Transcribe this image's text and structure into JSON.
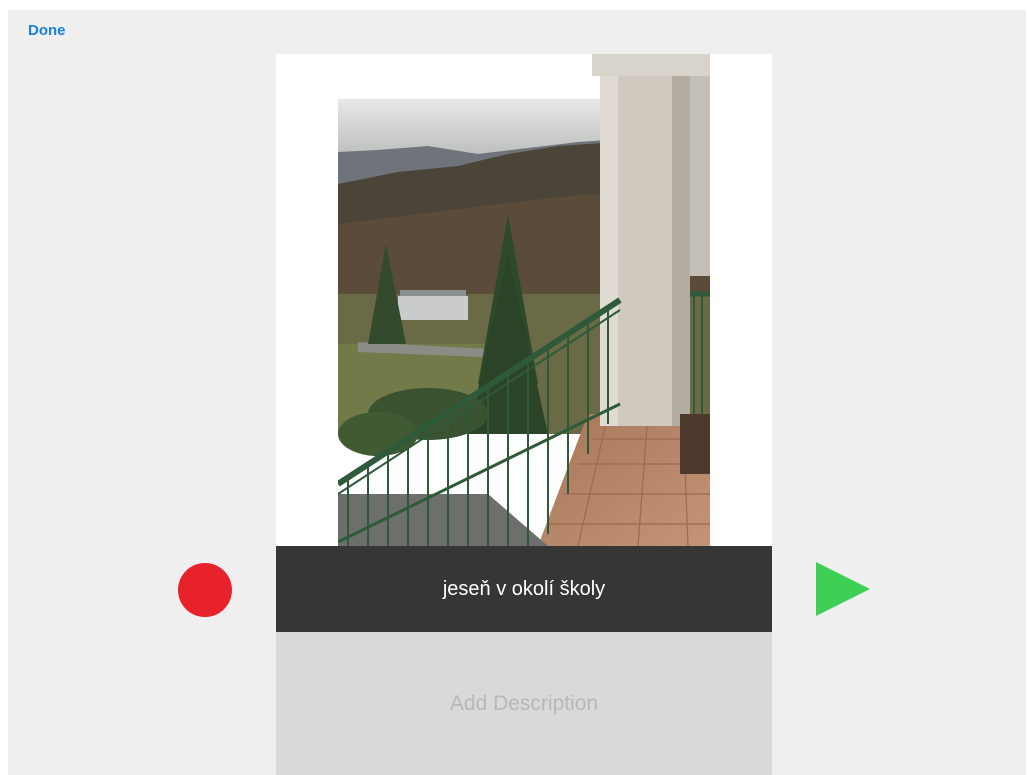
{
  "toolbar": {
    "done_label": "Done"
  },
  "photo": {
    "subject": "landscape-photo"
  },
  "slide": {
    "title": "jeseň v okolí školy",
    "description_placeholder": "Add Description"
  },
  "controls": {
    "record_icon": "record-icon",
    "play_icon": "play-icon"
  },
  "colors": {
    "accent": "#1a7fe0",
    "record": "#e8222a",
    "play": "#3ecf57",
    "title_bar": "#363636",
    "description_bg": "#d9d9d9",
    "background": "#efefef"
  }
}
